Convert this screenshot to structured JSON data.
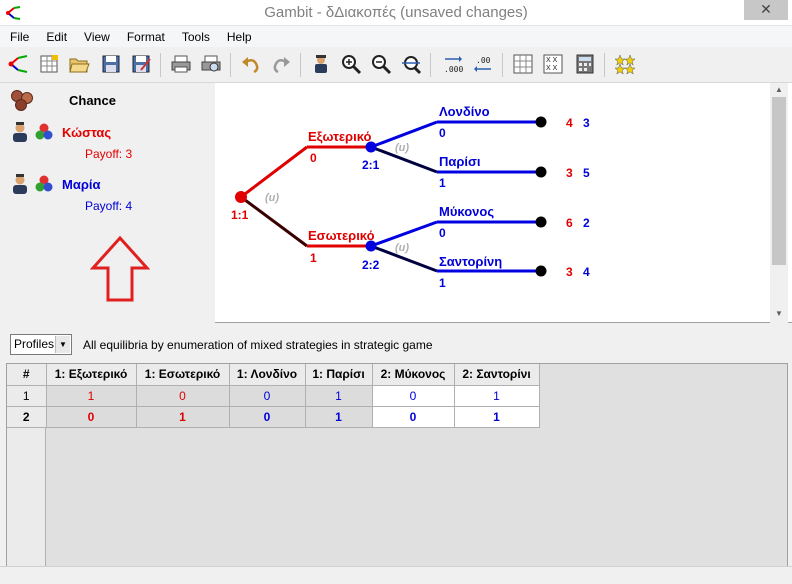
{
  "window": {
    "title": "Gambit - δΔιακοπές (unsaved changes)",
    "close_glyph": "✕"
  },
  "menu": [
    "File",
    "Edit",
    "View",
    "Format",
    "Tools",
    "Help"
  ],
  "toolbar_icons": [
    "new-game-icon",
    "new-table-icon",
    "open-icon",
    "save-icon",
    "save-as-icon",
    "print-icon",
    "print-preview-icon",
    "undo-icon",
    "redo-icon",
    "add-player-icon",
    "zoom-in-icon",
    "zoom-out-icon",
    "zoom-fit-icon",
    "decimals-more-icon",
    "decimals-less-icon",
    "strategic-table-icon",
    "dominance-icon",
    "calculator-icon",
    "equilibrium-icon"
  ],
  "players": {
    "chance": {
      "name": "Chance",
      "color": "#8fc93a"
    },
    "p1": {
      "name": "Κώστας",
      "payoff": "Payoff: 3",
      "color": "#e60000"
    },
    "p2": {
      "name": "Μαρία",
      "payoff": "Payoff: 4",
      "color": "#0000d8"
    }
  },
  "tree": {
    "root_label": "1:1",
    "root_prob": "(u)",
    "branches": [
      {
        "action": "Εξωτερικό",
        "prob": "0",
        "node": "2:1",
        "node_prob": "(u)",
        "children": [
          {
            "action": "Λονδίνο",
            "prob": "0",
            "payoff1": "4",
            "payoff2": "3"
          },
          {
            "action": "Παρίσι",
            "prob": "1",
            "payoff1": "3",
            "payoff2": "5"
          }
        ]
      },
      {
        "action": "Εσωτερικό",
        "prob": "1",
        "node": "2:2",
        "node_prob": "(u)",
        "children": [
          {
            "action": "Μύκονος",
            "prob": "0",
            "payoff1": "6",
            "payoff2": "2"
          },
          {
            "action": "Σαντορίνη",
            "prob": "1",
            "payoff1": "3",
            "payoff2": "4"
          }
        ]
      }
    ]
  },
  "equilibria": {
    "view_select": "Profiles",
    "description": "All equilibria by enumeration of mixed strategies in strategic game",
    "columns": [
      "#",
      "1: Εξωτερικό",
      "1: Εσωτερικό",
      "1: Λονδίνο",
      "1: Παρίσι",
      "2: Μύκονος",
      "2: Σαντορίνι"
    ],
    "rows": [
      {
        "id": "1",
        "values": [
          "1",
          "0",
          "0",
          "1",
          "0",
          "1"
        ]
      },
      {
        "id": "2",
        "values": [
          "0",
          "1",
          "0",
          "1",
          "0",
          "1"
        ]
      }
    ]
  }
}
